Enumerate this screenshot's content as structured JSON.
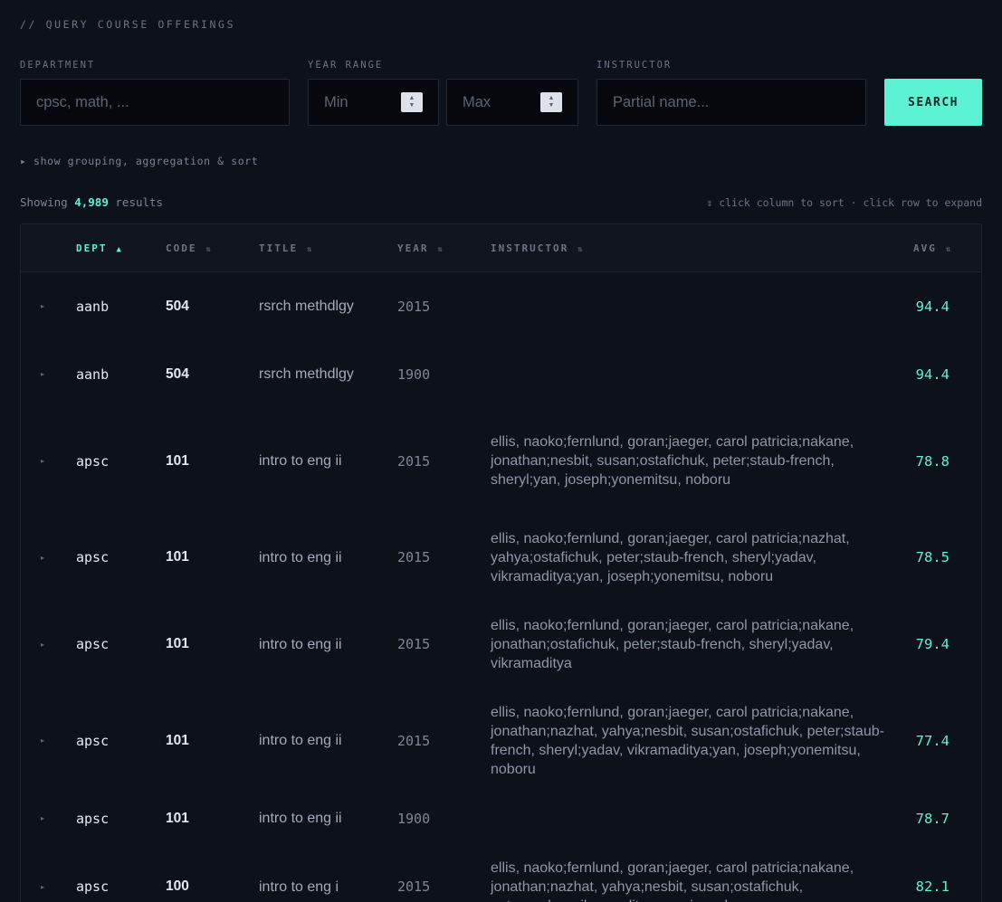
{
  "section_title": "// QUERY COURSE OFFERINGS",
  "filters": {
    "department": {
      "label": "DEPARTMENT",
      "placeholder": "cpsc, math, ..."
    },
    "year_range": {
      "label": "YEAR RANGE",
      "min_placeholder": "Min",
      "max_placeholder": "Max"
    },
    "instructor": {
      "label": "INSTRUCTOR",
      "placeholder": "Partial name..."
    },
    "search_label": "SEARCH"
  },
  "options_toggle": "▸ show grouping, aggregation & sort",
  "results": {
    "prefix": "Showing",
    "count": "4,989",
    "suffix": "results",
    "hint": "⇕ click column to sort · click row to expand"
  },
  "table": {
    "columns": [
      {
        "label": "DEPT",
        "sort": "▲",
        "active": true
      },
      {
        "label": "CODE",
        "sort": "⇅",
        "active": false
      },
      {
        "label": "TITLE",
        "sort": "⇅",
        "active": false
      },
      {
        "label": "YEAR",
        "sort": "⇅",
        "active": false
      },
      {
        "label": "INSTRUCTOR",
        "sort": "⇅",
        "active": false
      },
      {
        "label": "AVG",
        "sort": "⇅",
        "active": false
      }
    ],
    "rows": [
      {
        "dept": "aanb",
        "code": "504",
        "title": "rsrch methdlgy",
        "year": "2015",
        "instructor": "",
        "avg": "94.4"
      },
      {
        "dept": "aanb",
        "code": "504",
        "title": "rsrch methdlgy",
        "year": "1900",
        "instructor": "",
        "avg": "94.4"
      },
      {
        "dept": "apsc",
        "code": "101",
        "title": "intro to eng ii",
        "year": "2015",
        "instructor": "ellis, naoko;fernlund, goran;jaeger, carol patricia;nakane, jonathan;nesbit, susan;ostafichuk, peter;staub-french, sheryl;yan, joseph;yonemitsu, noboru",
        "avg": "78.8"
      },
      {
        "dept": "apsc",
        "code": "101",
        "title": "intro to eng ii",
        "year": "2015",
        "instructor": "ellis, naoko;fernlund, goran;jaeger, carol patricia;nazhat, yahya;ostafichuk, peter;staub-french, sheryl;yadav, vikramaditya;yan, joseph;yonemitsu, noboru",
        "avg": "78.5"
      },
      {
        "dept": "apsc",
        "code": "101",
        "title": "intro to eng ii",
        "year": "2015",
        "instructor": "ellis, naoko;fernlund, goran;jaeger, carol patricia;nakane, jonathan;ostafichuk, peter;staub-french, sheryl;yadav, vikramaditya",
        "avg": "79.4"
      },
      {
        "dept": "apsc",
        "code": "101",
        "title": "intro to eng ii",
        "year": "2015",
        "instructor": "ellis, naoko;fernlund, goran;jaeger, carol patricia;nakane, jonathan;nazhat, yahya;nesbit, susan;ostafichuk, peter;staub-french, sheryl;yadav, vikramaditya;yan, joseph;yonemitsu, noboru",
        "avg": "77.4"
      },
      {
        "dept": "apsc",
        "code": "101",
        "title": "intro to eng ii",
        "year": "1900",
        "instructor": "",
        "avg": "78.7"
      },
      {
        "dept": "apsc",
        "code": "100",
        "title": "intro to eng i",
        "year": "2015",
        "instructor": "ellis, naoko;fernlund, goran;jaeger, carol patricia;nakane, jonathan;nazhat, yahya;nesbit, susan;ostafichuk, peter;yadav, vikramaditya;yan, joseph",
        "avg": "82.1"
      }
    ]
  }
}
